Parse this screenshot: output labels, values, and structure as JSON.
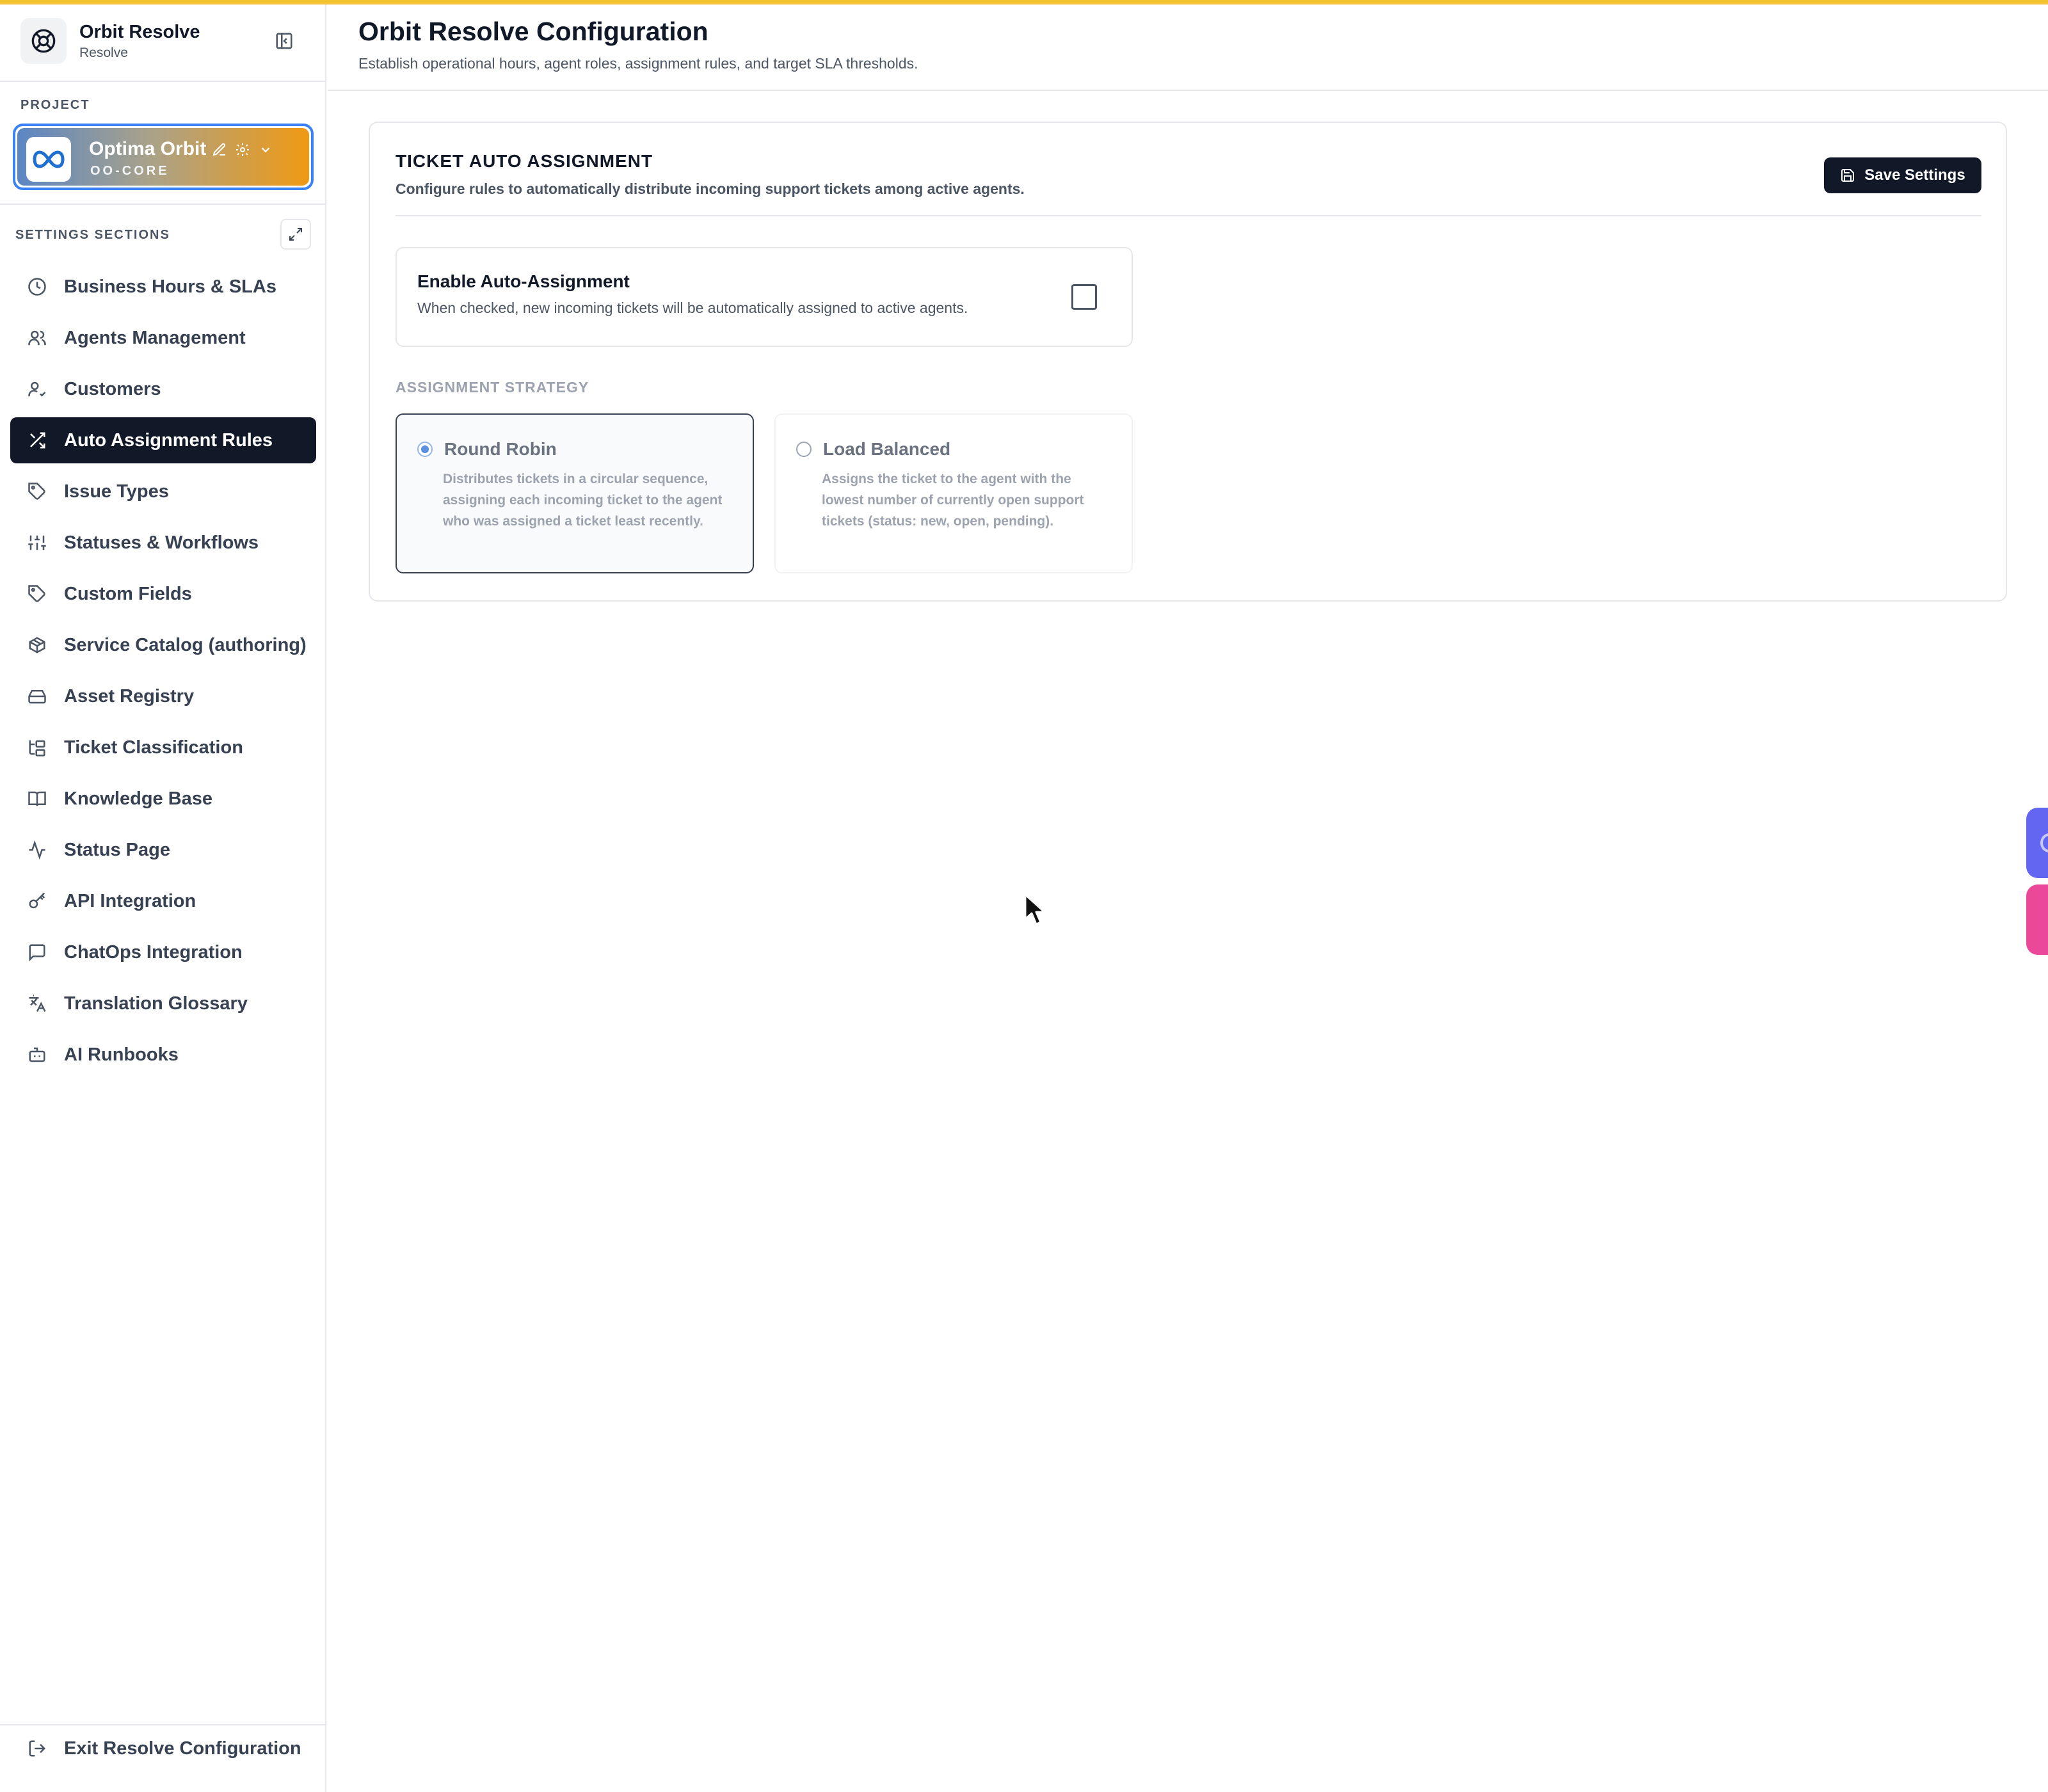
{
  "brand": {
    "title": "Orbit Resolve",
    "subtitle": "Resolve"
  },
  "project": {
    "section_label": "PROJECT",
    "name": "Optima Orbit",
    "code": "OO-CORE"
  },
  "sidebar": {
    "section_label": "SETTINGS SECTIONS",
    "items": [
      {
        "label": "Business Hours & SLAs",
        "icon": "clock-icon"
      },
      {
        "label": "Agents Management",
        "icon": "users-icon"
      },
      {
        "label": "Customers",
        "icon": "user-check-icon"
      },
      {
        "label": "Auto Assignment Rules",
        "icon": "shuffle-icon",
        "active": true
      },
      {
        "label": "Issue Types",
        "icon": "tag-icon"
      },
      {
        "label": "Statuses & Workflows",
        "icon": "sliders-icon"
      },
      {
        "label": "Custom Fields",
        "icon": "tag-icon"
      },
      {
        "label": "Service Catalog (authoring)",
        "icon": "package-icon"
      },
      {
        "label": "Asset Registry",
        "icon": "hard-drive-icon"
      },
      {
        "label": "Ticket Classification",
        "icon": "folder-tree-icon"
      },
      {
        "label": "Knowledge Base",
        "icon": "book-icon"
      },
      {
        "label": "Status Page",
        "icon": "activity-icon"
      },
      {
        "label": "API Integration",
        "icon": "key-icon"
      },
      {
        "label": "ChatOps Integration",
        "icon": "message-square-icon"
      },
      {
        "label": "Translation Glossary",
        "icon": "languages-icon"
      },
      {
        "label": "AI Runbooks",
        "icon": "bot-icon"
      }
    ],
    "exit_label": "Exit Resolve Configuration"
  },
  "header": {
    "title": "Orbit Resolve Configuration",
    "subtitle": "Establish operational hours, agent roles, assignment rules, and target SLA thresholds."
  },
  "card": {
    "title": "TICKET AUTO ASSIGNMENT",
    "description": "Configure rules to automatically distribute incoming support tickets among active agents.",
    "save_label": "Save Settings",
    "toggle": {
      "title": "Enable Auto-Assignment",
      "description": "When checked, new incoming tickets will be automatically assigned to active agents.",
      "checked": false
    },
    "strategy_label": "ASSIGNMENT STRATEGY",
    "options": [
      {
        "title": "Round Robin",
        "description": "Distributes tickets in a circular sequence, assigning each incoming ticket to the agent who was assigned a ticket least recently.",
        "selected": true
      },
      {
        "title": "Load Balanced",
        "description": "Assigns the ticket to the agent with the lowest number of currently open support tickets (status: new, open, pending).",
        "selected": false
      }
    ]
  },
  "colors": {
    "accent_bar": "#f5c232",
    "active_nav": "#111827",
    "project_border": "#3b82f6",
    "radio_selected": "#5b8fe0"
  }
}
